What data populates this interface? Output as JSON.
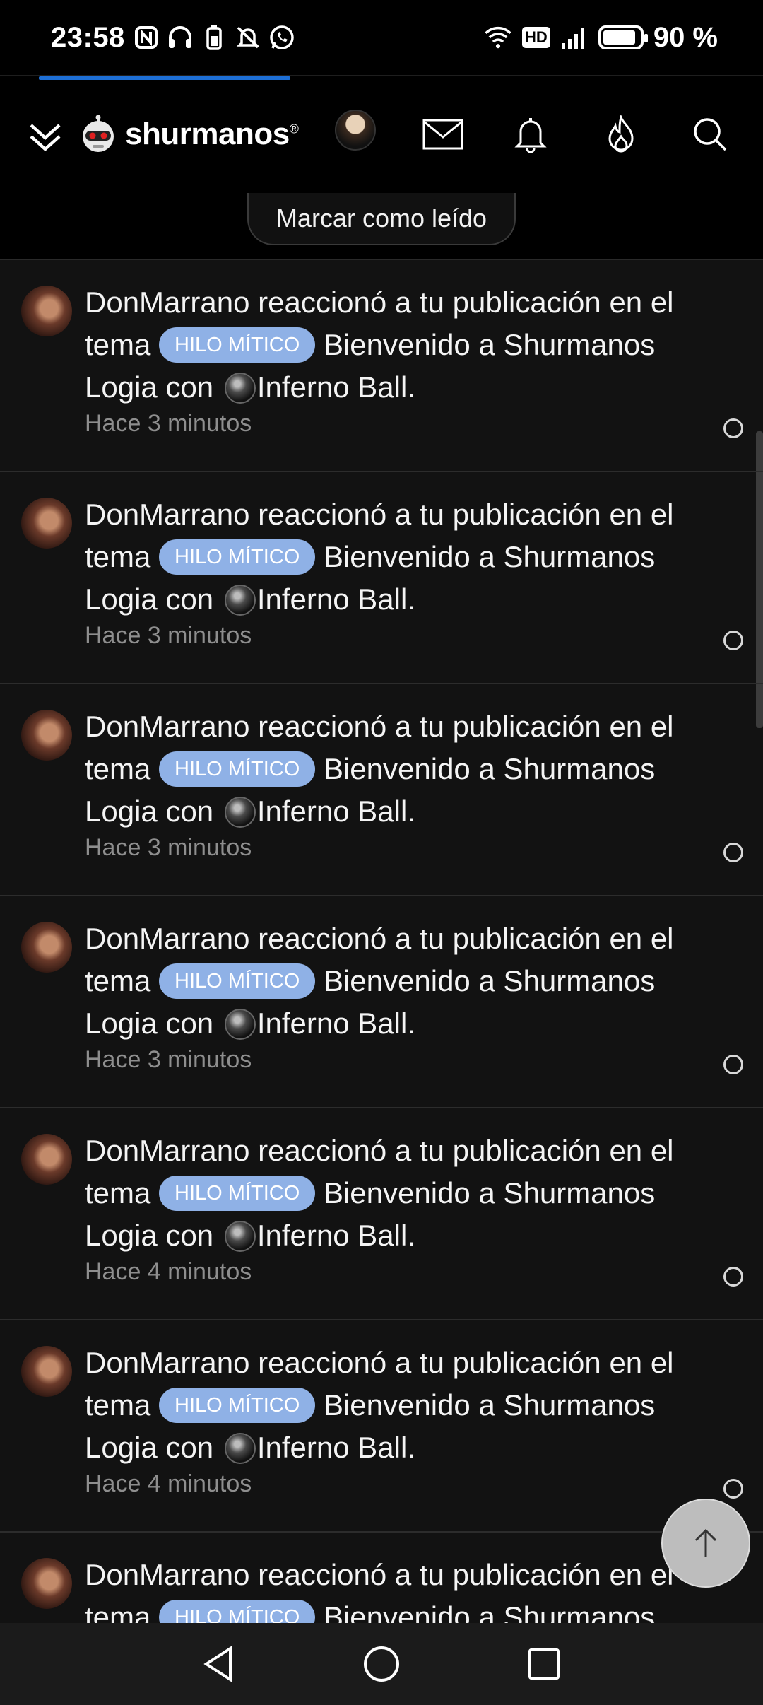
{
  "status_bar": {
    "time": "23:58",
    "battery": "90 %",
    "hd_label": "HD",
    "battery_level": 0.9
  },
  "header": {
    "logo_text": "shurmanos",
    "logo_mark": "®",
    "icons": [
      "chevron-down-icon",
      "robot-logo-icon",
      "mail-icon",
      "bell-icon",
      "fire-icon",
      "search-icon"
    ]
  },
  "actions": {
    "mark_read": "Marcar como leído"
  },
  "notifications": [
    {
      "user": "DonMarrano",
      "pre": "reaccionó a tu publicación en el tema",
      "tag": "HILO MÍTICO",
      "thread": "Bienvenido a Shurmanos Logia",
      "con": "con",
      "reaction": "Inferno Ball.",
      "time": "Hace 3 minutos"
    },
    {
      "user": "DonMarrano",
      "pre": "reaccionó a tu publicación en el tema",
      "tag": "HILO MÍTICO",
      "thread": "Bienvenido a Shurmanos Logia",
      "con": "con",
      "reaction": "Inferno Ball.",
      "time": "Hace 3 minutos"
    },
    {
      "user": "DonMarrano",
      "pre": "reaccionó a tu publicación en el tema",
      "tag": "HILO MÍTICO",
      "thread": "Bienvenido a Shurmanos Logia",
      "con": "con",
      "reaction": "Inferno Ball.",
      "time": "Hace 3 minutos"
    },
    {
      "user": "DonMarrano",
      "pre": "reaccionó a tu publicación en el tema",
      "tag": "HILO MÍTICO",
      "thread": "Bienvenido a Shurmanos Logia",
      "con": "con",
      "reaction": "Inferno Ball.",
      "time": "Hace 3 minutos"
    },
    {
      "user": "DonMarrano",
      "pre": "reaccionó a tu publicación en el tema",
      "tag": "HILO MÍTICO",
      "thread": "Bienvenido a Shurmanos Logia",
      "con": "con",
      "reaction": "Inferno Ball.",
      "time": "Hace 4 minutos"
    },
    {
      "user": "DonMarrano",
      "pre": "reaccionó a tu publicación en el tema",
      "tag": "HILO MÍTICO",
      "thread": "Bienvenido a Shurmanos Logia",
      "con": "con",
      "reaction": "Inferno Ball.",
      "time": "Hace 4 minutos"
    },
    {
      "user": "DonMarrano",
      "pre": "reaccionó a tu publicación en el tema",
      "tag": "HILO MÍTICO",
      "thread": "Bienvenido a Shurmanos",
      "con": "",
      "reaction": "",
      "time": ""
    }
  ],
  "colors": {
    "background": "#000000",
    "list_background": "#121212",
    "tag": "#8fb1e6",
    "progress": "#1d6fd6",
    "muted_text": "#8e8e8e"
  }
}
